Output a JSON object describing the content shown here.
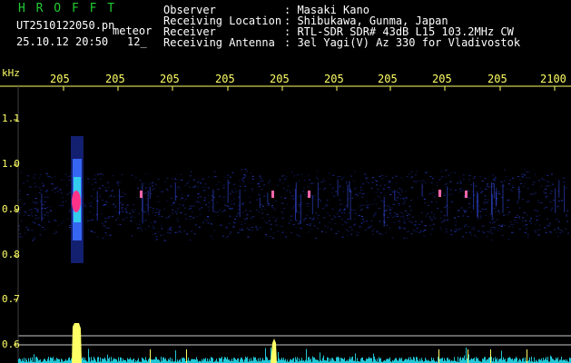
{
  "app_title": "H R O F F T",
  "file_name": "UT2510122050.pn",
  "mode_label": "meteor",
  "date_time": "25.10.12 20:50",
  "count_value": "12_",
  "info": {
    "observer_label": "Observer",
    "observer_value": ": Masaki Kano",
    "location_label": "Receiving Location",
    "location_value": ": Shibukawa, Gunma, Japan",
    "receiver_label": "Receiver",
    "receiver_value": ": RTL-SDR SDR# 43dB L15 103.2MHz CW",
    "antenna_label": "Receiving Antenna",
    "antenna_value": ": 3el Yagi(V) Az 330 for Vladivostok"
  },
  "axis": {
    "unit": "kHz",
    "y_ticks": [
      "1.1",
      "1.0",
      "0.9",
      "0.8",
      "0.7",
      "0.6"
    ],
    "time_ticks": [
      "205",
      "205",
      "205",
      "205",
      "205",
      "205",
      "205",
      "205",
      "205",
      "2100"
    ]
  },
  "colors": {
    "background": "#000000",
    "header_green": "#22cc33",
    "axis_yellow": "#ffff66",
    "signal_magenta": "#ff3388",
    "noise_blue": "#1a2a9a"
  }
}
